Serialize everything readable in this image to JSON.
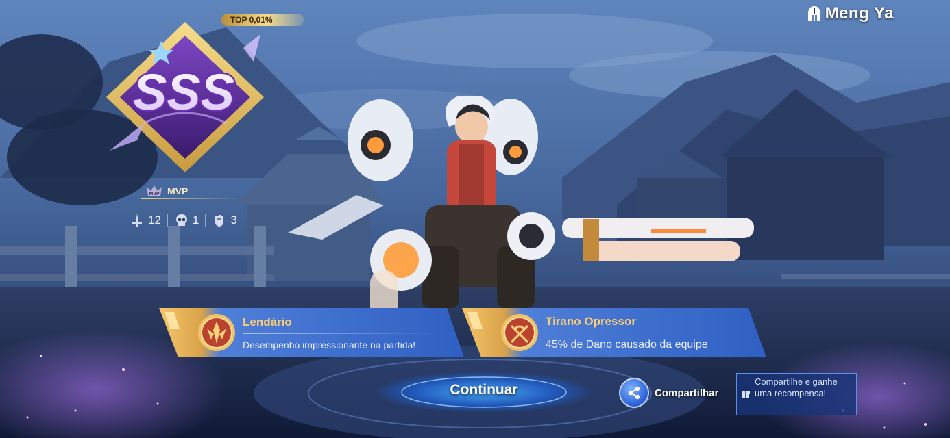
{
  "player": {
    "name": "Meng Ya",
    "icon": "helmet-icon"
  },
  "rank": {
    "grade": "SSS",
    "top_badge": "TOP 0,01%",
    "mvp_label": "MVP",
    "mvp_icon_text": "MVP"
  },
  "stats": [
    {
      "icon": "sword-kills-icon",
      "value": "12"
    },
    {
      "icon": "skull-deaths-icon",
      "value": "1"
    },
    {
      "icon": "fist-assists-icon",
      "value": "3"
    }
  ],
  "achievements": [
    {
      "icon": "legendary-medal-icon",
      "title": "Lendário",
      "description": "Desempenho impressionante na partida!"
    },
    {
      "icon": "oppressor-medal-icon",
      "title": "Tirano Opressor",
      "description": "45% de Dano causado da equipe"
    }
  ],
  "actions": {
    "continue_label": "Continuar",
    "share_label": "Compartilhar",
    "share_icon": "share-icon",
    "reward_tip": "Compartilhe e ganhe uma recompensa!",
    "reward_icon": "gift-icon"
  },
  "colors": {
    "banner_blue": "#3f76d9",
    "banner_gold": "#f6c66a",
    "title_gold": "#ffcd72",
    "sss_purple": "#7a3fc2"
  }
}
